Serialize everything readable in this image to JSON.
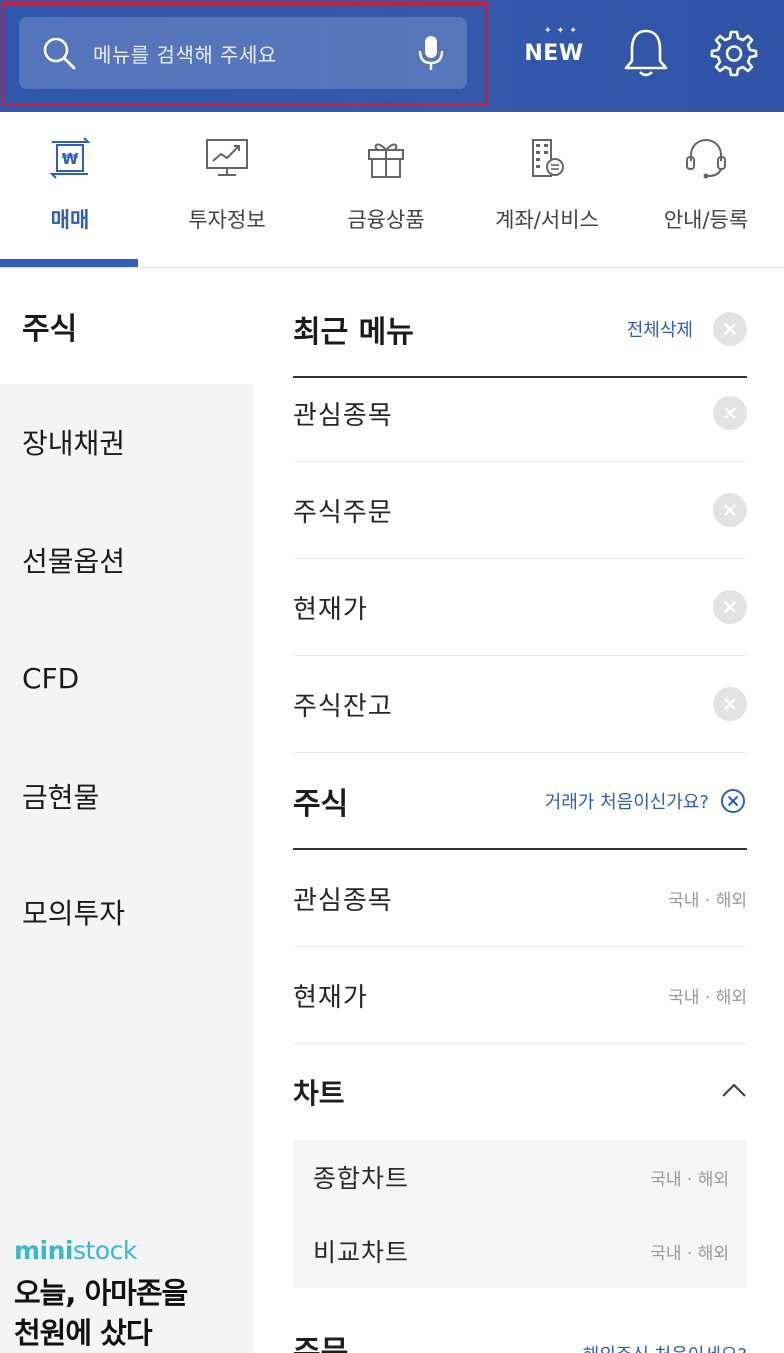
{
  "colors": {
    "header": "#3458ab",
    "accent": "#2f5fb8",
    "highlight": "#d8192f",
    "brand": "#3bb8c9"
  },
  "header": {
    "search_placeholder": "메뉴를 검색해 주세요",
    "new_label": "NEW",
    "icons": [
      "search-icon",
      "mic-icon",
      "bell-icon",
      "gear-icon"
    ]
  },
  "tabs": [
    {
      "label": "매매",
      "icon": "won-exchange-icon",
      "active": true
    },
    {
      "label": "투자정보",
      "icon": "chart-monitor-icon",
      "active": false
    },
    {
      "label": "금융상품",
      "icon": "gift-icon",
      "active": false
    },
    {
      "label": "계좌/서비스",
      "icon": "building-icon",
      "active": false
    },
    {
      "label": "안내/등록",
      "icon": "headset-icon",
      "active": false
    }
  ],
  "sidebar": {
    "items": [
      {
        "label": "주식",
        "active": true
      },
      {
        "label": "장내채권",
        "active": false
      },
      {
        "label": "선물옵션",
        "active": false
      },
      {
        "label": "CFD",
        "active": false
      },
      {
        "label": "금현물",
        "active": false
      },
      {
        "label": "모의투자",
        "active": false
      }
    ],
    "promo": {
      "brand_bold": "mini",
      "brand_light": "stock",
      "line1": "오늘, 아마존을",
      "line2": "천원에 샀다"
    }
  },
  "recent": {
    "title": "최근 메뉴",
    "clear_all": "전체삭제",
    "items": [
      "관심종목",
      "주식주문",
      "현재가",
      "주식잔고"
    ]
  },
  "stock": {
    "title": "주식",
    "help_link": "거래가 처음이신가요?",
    "rows": [
      {
        "label": "관심종목",
        "sub": "국내 · 해외"
      },
      {
        "label": "현재가",
        "sub": "국내 · 해외"
      }
    ],
    "chart": {
      "title": "차트",
      "items": [
        {
          "label": "종합차트",
          "sub": "국내 · 해외"
        },
        {
          "label": "비교차트",
          "sub": "국내 · 해외"
        }
      ]
    },
    "next_title": "주문",
    "next_link": "해외주식 처음이세요?"
  }
}
